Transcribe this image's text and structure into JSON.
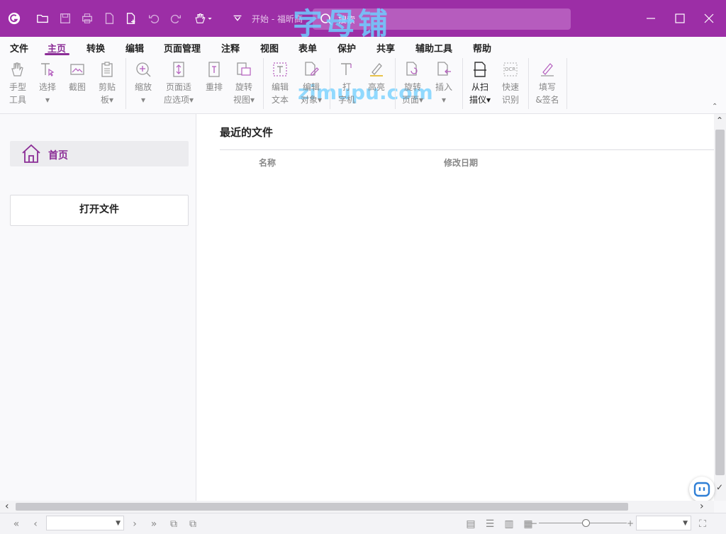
{
  "titlebar": {
    "title": "开始 - 福昕高",
    "search_label": "搜索",
    "watermark": "字母铺",
    "watermark_url": "zimupu.com",
    "accent": "#9c2ea6"
  },
  "tabs": [
    "文件",
    "主页",
    "转换",
    "编辑",
    "页面管理",
    "注释",
    "视图",
    "表单",
    "保护",
    "共享",
    "辅助工具",
    "帮助"
  ],
  "active_tab": "主页",
  "tools": {
    "hand": "手型\n工具",
    "select": "选择\n▾",
    "snapshot": "截图",
    "clipboard": "剪贴\n板▾",
    "zoom": "缩放\n▾",
    "fit_page": "页面适\n应选项▾",
    "reflow": "重排",
    "rotate_view": "旋转\n视图▾",
    "edit_text": "编辑\n文本",
    "edit_object": "编辑\n对象▾",
    "typewriter": "打\n字机",
    "highlight": "高亮",
    "rotate_page": "旋转\n页面▾",
    "insert": "插入\n▾",
    "from_scanner": "从扫\n描仪▾",
    "quick_ocr": "快速\n识别",
    "fill_sign": "填写\n&签名"
  },
  "sidebar": {
    "home_label": "首页",
    "open_file_label": "打开文件"
  },
  "main": {
    "recent_title": "最近的文件",
    "col_name": "名称",
    "col_modified": "修改日期"
  },
  "statusbar": {
    "page_value": "",
    "zoom_value": ""
  }
}
